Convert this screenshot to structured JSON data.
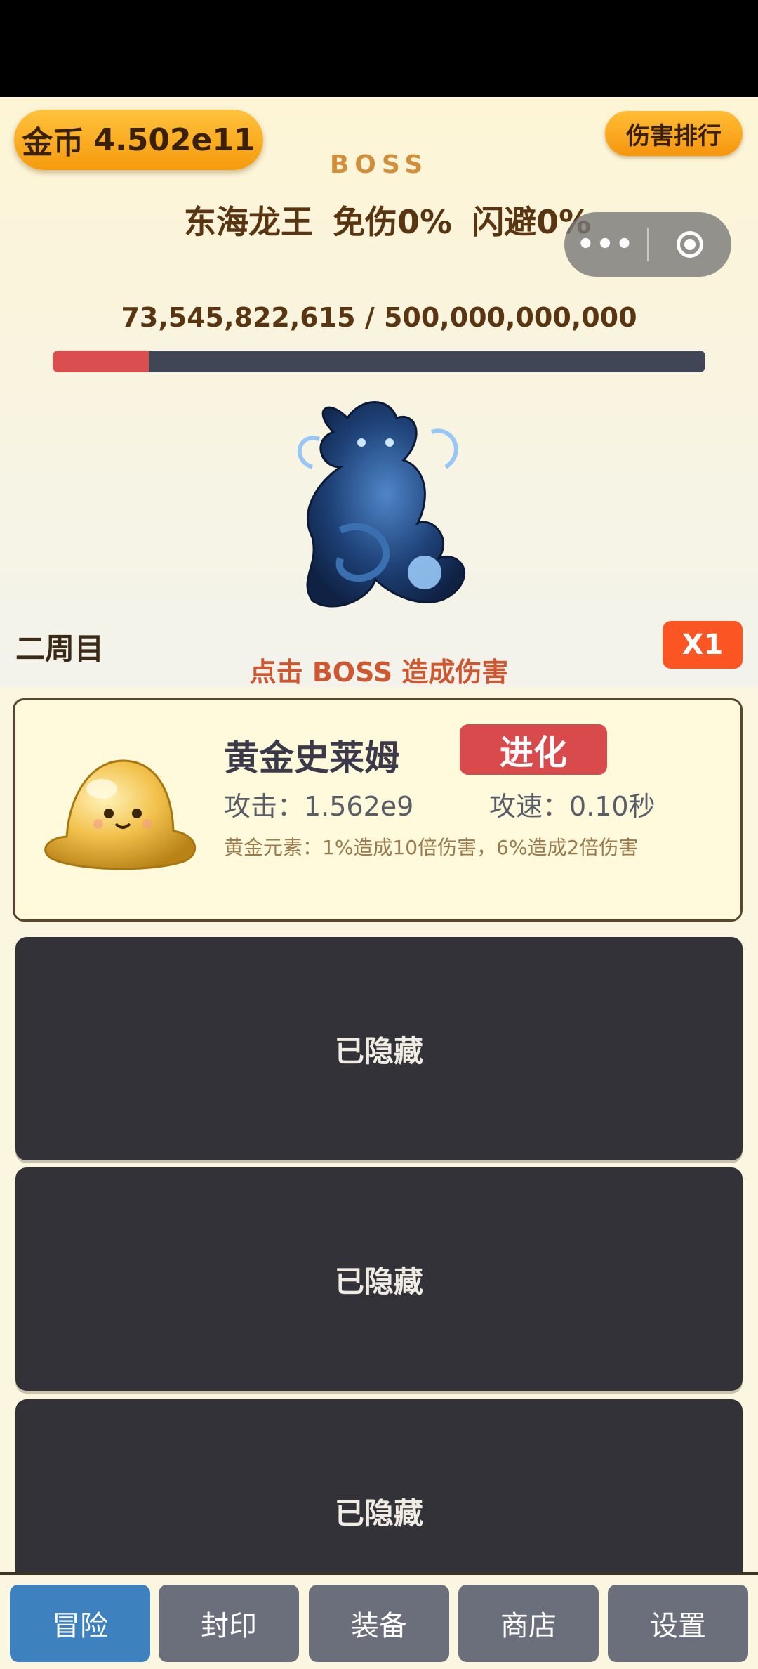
{
  "header": {
    "coin_label": "金币",
    "coin_value": "4.502e11",
    "rank_button": "伤害排行"
  },
  "boss": {
    "section_label": "BOSS",
    "name": "东海龙王",
    "damage_reduction": "免伤0%",
    "dodge": "闪避0%",
    "hp_text": "73,545,822,615 / 500,000,000,000",
    "hp_current": 73545822615,
    "hp_max": 500000000000,
    "round_label": "二周目",
    "speed_label": "X1",
    "tap_hint": "点击 BOSS 造成伤害"
  },
  "pet": {
    "name": "黄金史莱姆",
    "evolve_label": "进化",
    "attack": "攻击：1.562e9",
    "speed": "攻速：0.10秒",
    "skill": "黄金元素：1%造成10倍伤害，6%造成2倍伤害"
  },
  "hidden_slots": [
    {
      "label": "已隐藏"
    },
    {
      "label": "已隐藏"
    },
    {
      "label": "已隐藏"
    }
  ],
  "nav": {
    "tabs": [
      {
        "label": "冒险",
        "active": true
      },
      {
        "label": "封印",
        "active": false
      },
      {
        "label": "装备",
        "active": false
      },
      {
        "label": "商店",
        "active": false
      },
      {
        "label": "设置",
        "active": false
      }
    ]
  },
  "icons": {
    "more": "more-dots-icon",
    "close": "target-close-icon",
    "boss": "blue-dragon-image",
    "pet": "golden-slime-image"
  },
  "colors": {
    "hp_fill": "#da4e4f",
    "hp_track": "#414656",
    "evolve": "#d84a4c",
    "nav_active": "#3d82bf",
    "nav_inactive": "#6a6f7b",
    "coin_badge": "#f5a623"
  }
}
